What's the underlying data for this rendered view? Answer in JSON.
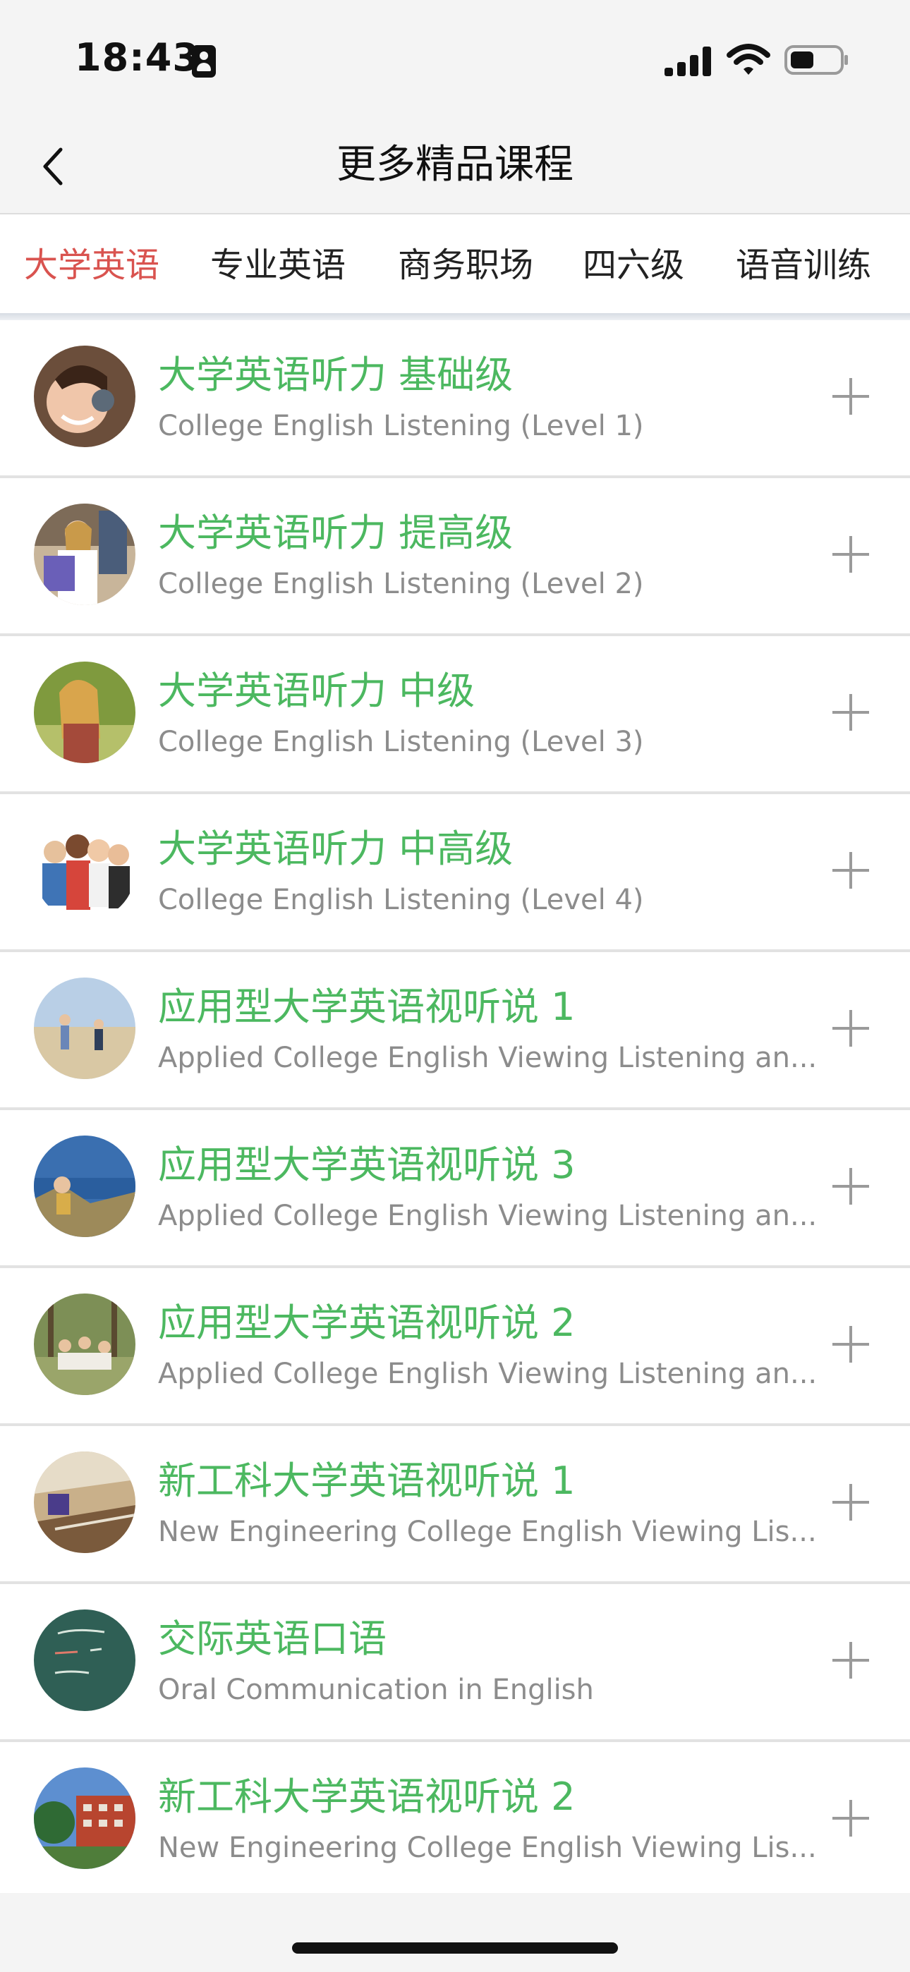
{
  "status_bar": {
    "time": "18:43",
    "icons": [
      "id-card-icon",
      "cellular-signal-icon",
      "wifi-icon",
      "battery-icon"
    ]
  },
  "header": {
    "back_icon": "chevron-left-icon",
    "title": "更多精品课程"
  },
  "tabs": [
    {
      "label": "大学英语",
      "active": true
    },
    {
      "label": "专业英语",
      "active": false
    },
    {
      "label": "商务职场",
      "active": false
    },
    {
      "label": "四六级",
      "active": false
    },
    {
      "label": "语音训练",
      "active": false
    }
  ],
  "colors": {
    "active_tab": "#d9534f",
    "course_title": "#4cb860",
    "course_subtitle": "#8c8c8c",
    "background": "#f4f4f4"
  },
  "courses": [
    {
      "title": "大学英语听力 基础级",
      "subtitle": "College English Listening (Level 1)",
      "action_icon": "plus-icon"
    },
    {
      "title": "大学英语听力 提高级",
      "subtitle": "College English Listening (Level 2)",
      "action_icon": "plus-icon"
    },
    {
      "title": "大学英语听力 中级",
      "subtitle": "College English Listening (Level 3)",
      "action_icon": "plus-icon"
    },
    {
      "title": "大学英语听力 中高级",
      "subtitle": "College English Listening (Level 4)",
      "action_icon": "plus-icon"
    },
    {
      "title": "应用型大学英语视听说 1",
      "subtitle": "Applied College English Viewing Listening an...",
      "action_icon": "plus-icon"
    },
    {
      "title": "应用型大学英语视听说 3",
      "subtitle": "Applied College English Viewing Listening an...",
      "action_icon": "plus-icon"
    },
    {
      "title": "应用型大学英语视听说 2",
      "subtitle": "Applied College English Viewing Listening an...",
      "action_icon": "plus-icon"
    },
    {
      "title": "新工科大学英语视听说 1",
      "subtitle": "New Engineering College English Viewing Lis...",
      "action_icon": "plus-icon"
    },
    {
      "title": "交际英语口语",
      "subtitle": "Oral Communication in English",
      "action_icon": "plus-icon"
    },
    {
      "title": "新工科大学英语视听说 2",
      "subtitle": "New Engineering College English Viewing Lis...",
      "action_icon": "plus-icon"
    }
  ]
}
